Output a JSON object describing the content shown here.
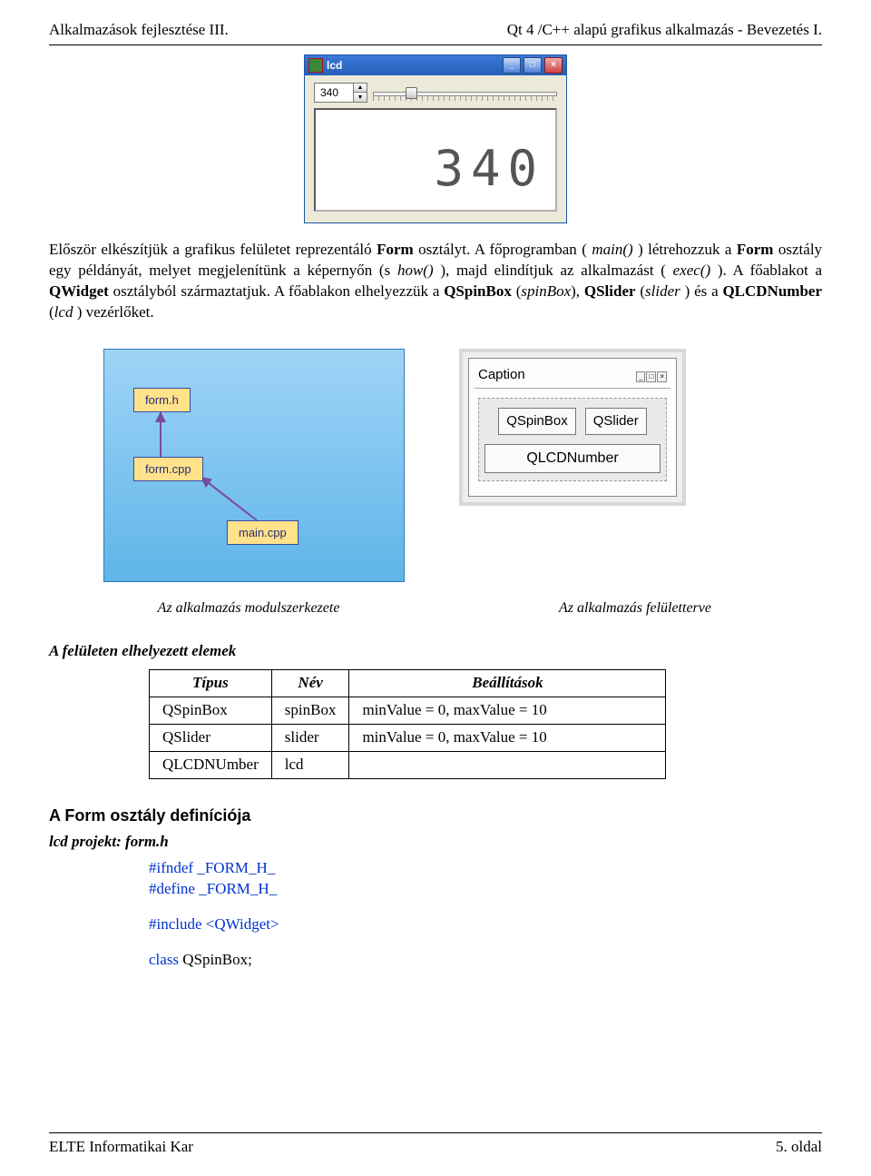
{
  "header": {
    "left": "Alkalmazások fejlesztése III.",
    "right": "Qt 4 /C++ alapú grafikus alkalmazás -  Bevezetés I."
  },
  "app_window": {
    "title": "lcd",
    "spin_value": "340",
    "lcd_value": "340"
  },
  "paragraph": {
    "p1_a": "Először elkészítjük a grafikus felületet reprezentáló ",
    "p1_form": "Form",
    "p1_b": " osztályt. A főprogramban (",
    "p1_main": "main()",
    "p1_c": ") létrehozzuk a ",
    "p1_form2": "Form",
    "p1_d": " osztály egy példányát, melyet megjelenítünk a képernyőn (s",
    "p1_show": "how()",
    "p1_e": "), majd elindítjuk az alkalmazást (",
    "p1_exec": "exec()",
    "p1_f": "). A főablakot  a ",
    "p1_qwidget": "QWidget",
    "p1_g": " osztályból származtatjuk. A főablakon elhelyezzük a ",
    "p1_qspin": "QSpinBox",
    "p1_spin_it": "spinBox",
    "p1_qslider": "QSlider",
    "p1_slider_it": "slider",
    "p1_and": ") és a ",
    "p1_qlcd": "QLCDNumber",
    "p1_lcd_it": "lcd",
    "p1_end": ") vezérlőket."
  },
  "module_fig": {
    "b1": "form.h",
    "b2": "form.cpp",
    "b3": "main.cpp"
  },
  "sketch": {
    "caption": "Caption",
    "spin": "QSpinBox",
    "slider": "QSlider",
    "lcd": "QLCDNumber"
  },
  "captions": {
    "c1": "Az alkalmazás modulszerkezete",
    "c2": "Az alkalmazás felületterve"
  },
  "elems_heading": "A felületen elhelyezett elemek",
  "table": {
    "th1": "Típus",
    "th2": "Név",
    "th3": "Beállítások",
    "rows": [
      {
        "t": "QSpinBox",
        "n": "spinBox",
        "s": "minValue = 0, maxValue = 10"
      },
      {
        "t": "QSlider",
        "n": "slider",
        "s": "minValue = 0, maxValue = 10"
      },
      {
        "t": "QLCDNUmber",
        "n": "lcd",
        "s": ""
      }
    ]
  },
  "code_section": {
    "heading": "A Form osztály definíciója",
    "project_line": "lcd projekt: form.h",
    "l1": "#ifndef _FORM_H_",
    "l2": "#define _FORM_H_",
    "l3": "#include <QWidget>",
    "l4a": "class",
    "l4b": " QSpinBox;"
  },
  "footer": {
    "left": "ELTE Informatikai Kar",
    "right": "5. oldal"
  }
}
